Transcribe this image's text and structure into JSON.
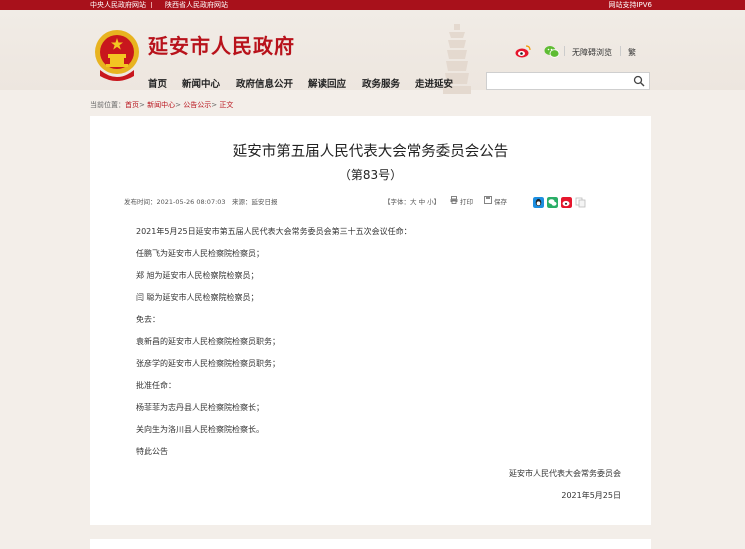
{
  "topbar": {
    "link_central": "中央人民政府网站",
    "link_province": "陕西省人民政府网站",
    "ipv6": "网站支持IPV6"
  },
  "header": {
    "site_title": "延安市人民政府",
    "accessibility": "无障碍浏览",
    "traditional": "繁",
    "nav": [
      "首页",
      "新闻中心",
      "政府信息公开",
      "解读回应",
      "政务服务",
      "走进延安"
    ],
    "search_placeholder": ""
  },
  "breadcrumb": {
    "label": "当前位置：",
    "items": [
      "首页",
      "新闻中心",
      "公告公示",
      "正文"
    ],
    "separator": ">"
  },
  "article": {
    "title": "延安市第五届人民代表大会常务委员会公告",
    "subtitle": "（第83号）",
    "publish_time": "发布时间：2021-05-26 08:07:03",
    "source": "来源：延安日报",
    "font_size": "【字体：大 中 小】",
    "print": "打印",
    "save": "保存",
    "paragraphs": [
      "2021年5月25日延安市第五届人民代表大会常务委员会第三十五次会议任命：",
      "任鹏飞为延安市人民检察院检察员；",
      "郑 旭为延安市人民检察院检察员；",
      "闫 聪为延安市人民检察院检察员；",
      "免去：",
      "袁新昌的延安市人民检察院检察员职务；",
      "张彦学的延安市人民检察院检察员职务；",
      "批准任命：",
      "杨菲菲为志丹县人民检察院检察长；",
      "关向生为洛川县人民检察院检察长。",
      "特此公告"
    ],
    "signature": "延安市人民代表大会常务委员会",
    "date": "2021年5月25日"
  },
  "colors": {
    "brand_red": "#b8121b",
    "topbar_red": "#a8111b",
    "background": "#f3eee9"
  },
  "icons": [
    "weibo-icon",
    "wechat-icon",
    "search-icon",
    "print-icon",
    "save-icon",
    "qq-icon",
    "wechat-share-icon",
    "weibo-share-icon",
    "copy-icon"
  ]
}
